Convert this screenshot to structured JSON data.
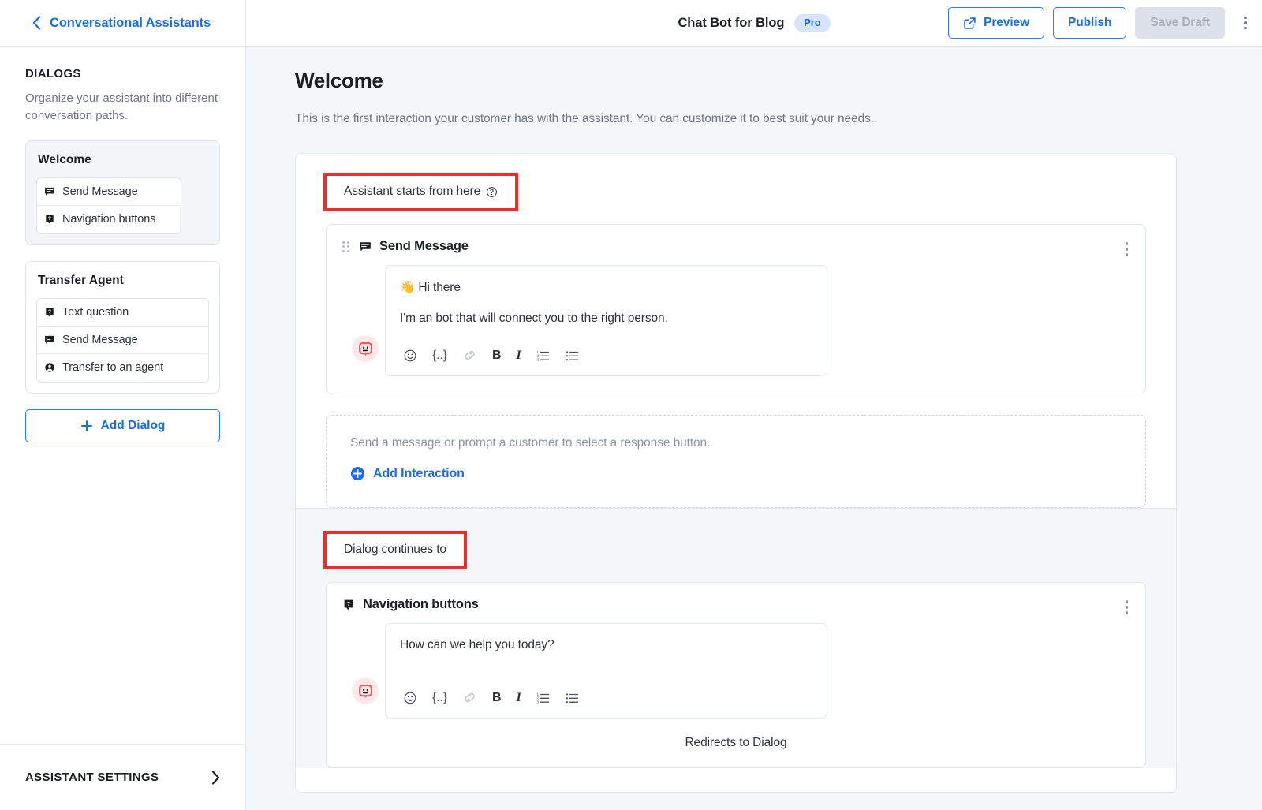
{
  "topbar": {
    "back_label": "Conversational Assistants",
    "back_icon": "chevron-left-icon",
    "doc_title": "Chat Bot for Blog",
    "badge": "Pro",
    "preview_label": "Preview",
    "preview_icon": "external-link-icon",
    "publish_label": "Publish",
    "save_draft_label": "Save Draft",
    "overflow_icon": "kebab-menu-icon",
    "accent": "#1a6ce7"
  },
  "sidebar": {
    "title": "DIALOGS",
    "description": "Organize your assistant into different conversation paths.",
    "dialogs": [
      {
        "name": "Welcome",
        "active": true,
        "nodes": [
          {
            "label": "Send Message",
            "icon": "message-icon",
            "linked": false
          },
          {
            "label": "Navigation buttons",
            "icon": "question-message-icon",
            "linked": true,
            "link_icon": "link-icon"
          }
        ]
      },
      {
        "name": "Transfer Agent",
        "active": false,
        "nodes": [
          {
            "label": "Text question",
            "icon": "question-message-icon",
            "linked": false
          },
          {
            "label": "Send Message",
            "icon": "message-icon",
            "linked": false
          },
          {
            "label": "Transfer to an agent",
            "icon": "agent-icon",
            "linked": false
          }
        ]
      }
    ],
    "add_dialog_label": "Add Dialog",
    "add_dialog_icon": "plus-icon",
    "footer_label": "ASSISTANT SETTINGS",
    "footer_icon": "chevron-right-icon"
  },
  "main": {
    "page_title": "Welcome",
    "page_subtitle": "This is the first interaction your customer has with the assistant. You can customize it to best suit your needs.",
    "annotation_color": "#ef2b2b",
    "section_start": {
      "label": "Assistant starts from here",
      "help_icon": "help-circle-icon",
      "highlighted": true
    },
    "send_message_node": {
      "title": "Send Message",
      "icon": "message-icon",
      "drag_icon": "drag-handle-icon",
      "menu_icon": "kebab-menu-icon",
      "avatar_icon": "bot-avatar-icon",
      "lines": [
        "👋 Hi there",
        "I'm an bot that will connect you to the right person."
      ],
      "toolbar": [
        {
          "name": "emoji-icon",
          "glyph": "☺"
        },
        {
          "name": "variable-icon",
          "glyph": "{..}"
        },
        {
          "name": "link-icon",
          "glyph": "link"
        },
        {
          "name": "bold-icon",
          "glyph": "B"
        },
        {
          "name": "italic-icon",
          "glyph": "I"
        },
        {
          "name": "ordered-list-icon",
          "glyph": "ol"
        },
        {
          "name": "bullet-list-icon",
          "glyph": "ul"
        }
      ]
    },
    "add_zone": {
      "hint": "Send a message or prompt a customer to select a response button.",
      "button_label": "Add Interaction",
      "button_icon": "plus-circle-icon"
    },
    "section_continue": {
      "label": "Dialog continues to",
      "highlighted": true
    },
    "navigation_buttons_node": {
      "title": "Navigation buttons",
      "icon": "question-message-icon",
      "menu_icon": "kebab-menu-icon",
      "avatar_icon": "bot-avatar-icon",
      "lines": [
        "How can we help you today?"
      ],
      "toolbar": [
        {
          "name": "emoji-icon",
          "glyph": "☺"
        },
        {
          "name": "variable-icon",
          "glyph": "{..}"
        },
        {
          "name": "link-icon",
          "glyph": "link"
        },
        {
          "name": "bold-icon",
          "glyph": "B"
        },
        {
          "name": "italic-icon",
          "glyph": "I"
        },
        {
          "name": "ordered-list-icon",
          "glyph": "ol"
        },
        {
          "name": "bullet-list-icon",
          "glyph": "ul"
        }
      ],
      "footer_text": "Redirects to Dialog"
    }
  }
}
